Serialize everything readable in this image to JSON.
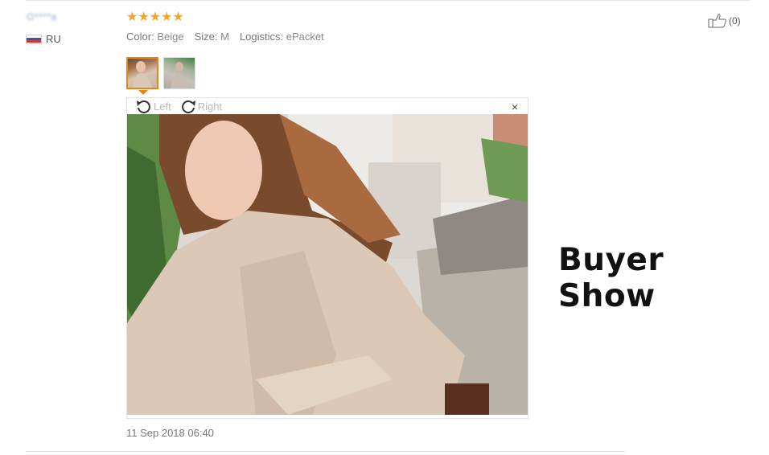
{
  "review": {
    "user_name": "O****a",
    "country_code": "RU",
    "rating": 5,
    "stars": [
      "★",
      "★",
      "★",
      "★",
      "★"
    ],
    "attributes": [
      {
        "key": "Color:",
        "value": "Beige"
      },
      {
        "key": "Size:",
        "value": "M"
      },
      {
        "key": "Logistics:",
        "value": "ePacket"
      }
    ],
    "helpful_count": "(0)",
    "date": "11 Sep 2018 06:40"
  },
  "viewer": {
    "rotate_left_label": "Left",
    "rotate_right_label": "Right",
    "close_label": "×"
  },
  "watermark": "Buyer Show",
  "colors": {
    "star": "#f5a623",
    "active_thumb": "#e8841a"
  }
}
